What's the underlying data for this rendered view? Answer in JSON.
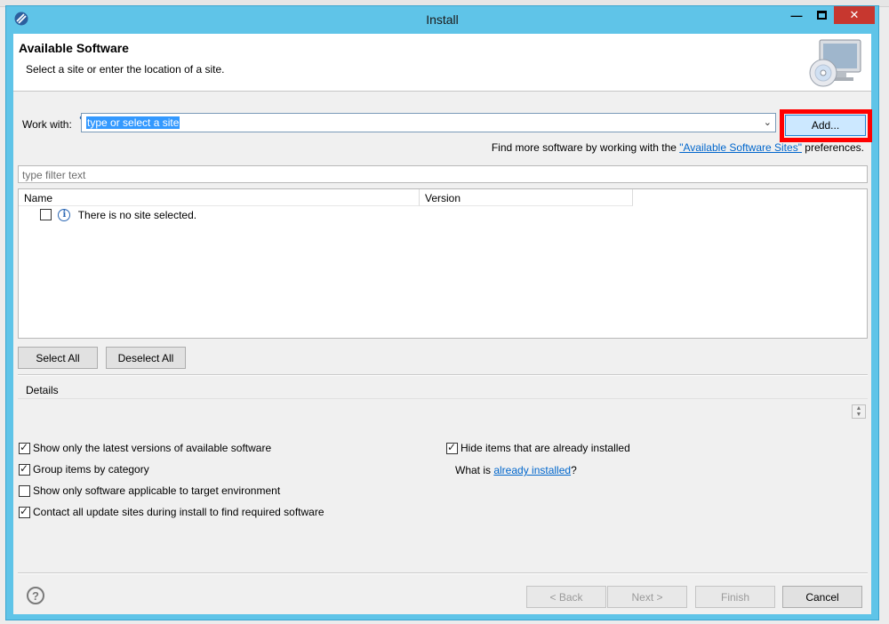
{
  "window": {
    "title": "Install"
  },
  "header": {
    "title": "Available Software",
    "subtitle": "Select a site or enter the location of a site."
  },
  "work_with": {
    "label": "Work with:",
    "value": "type or select a site",
    "add_label": "Add..."
  },
  "more_software": {
    "prefix": "Find more software by working with the ",
    "link": "\"Available Software Sites\"",
    "suffix": " preferences."
  },
  "filter": {
    "placeholder": "type filter text"
  },
  "table": {
    "columns": [
      "Name",
      "Version"
    ],
    "empty_message": "There is no site selected."
  },
  "buttons": {
    "select_all": "Select All",
    "deselect_all": "Deselect All",
    "back": "< Back",
    "next": "Next >",
    "finish": "Finish",
    "cancel": "Cancel"
  },
  "details": {
    "label": "Details"
  },
  "options": {
    "latest_only": {
      "label": "Show only the latest versions of available software",
      "checked": true
    },
    "group_by_category": {
      "label": "Group items by category",
      "checked": true
    },
    "applicable_only": {
      "label": "Show only software applicable to target environment",
      "checked": false
    },
    "contact_all": {
      "label": "Contact all update sites during install to find required software",
      "checked": true
    },
    "hide_installed": {
      "label": "Hide items that are already installed",
      "checked": true
    }
  },
  "what_is": {
    "prefix": "What is ",
    "link": "already installed",
    "suffix": "?"
  },
  "colors": {
    "titlebar": "#5fc4e8",
    "close_button": "#c7372f",
    "highlight": "#ff0000",
    "link": "#0066cc",
    "selection": "#3399ff"
  }
}
